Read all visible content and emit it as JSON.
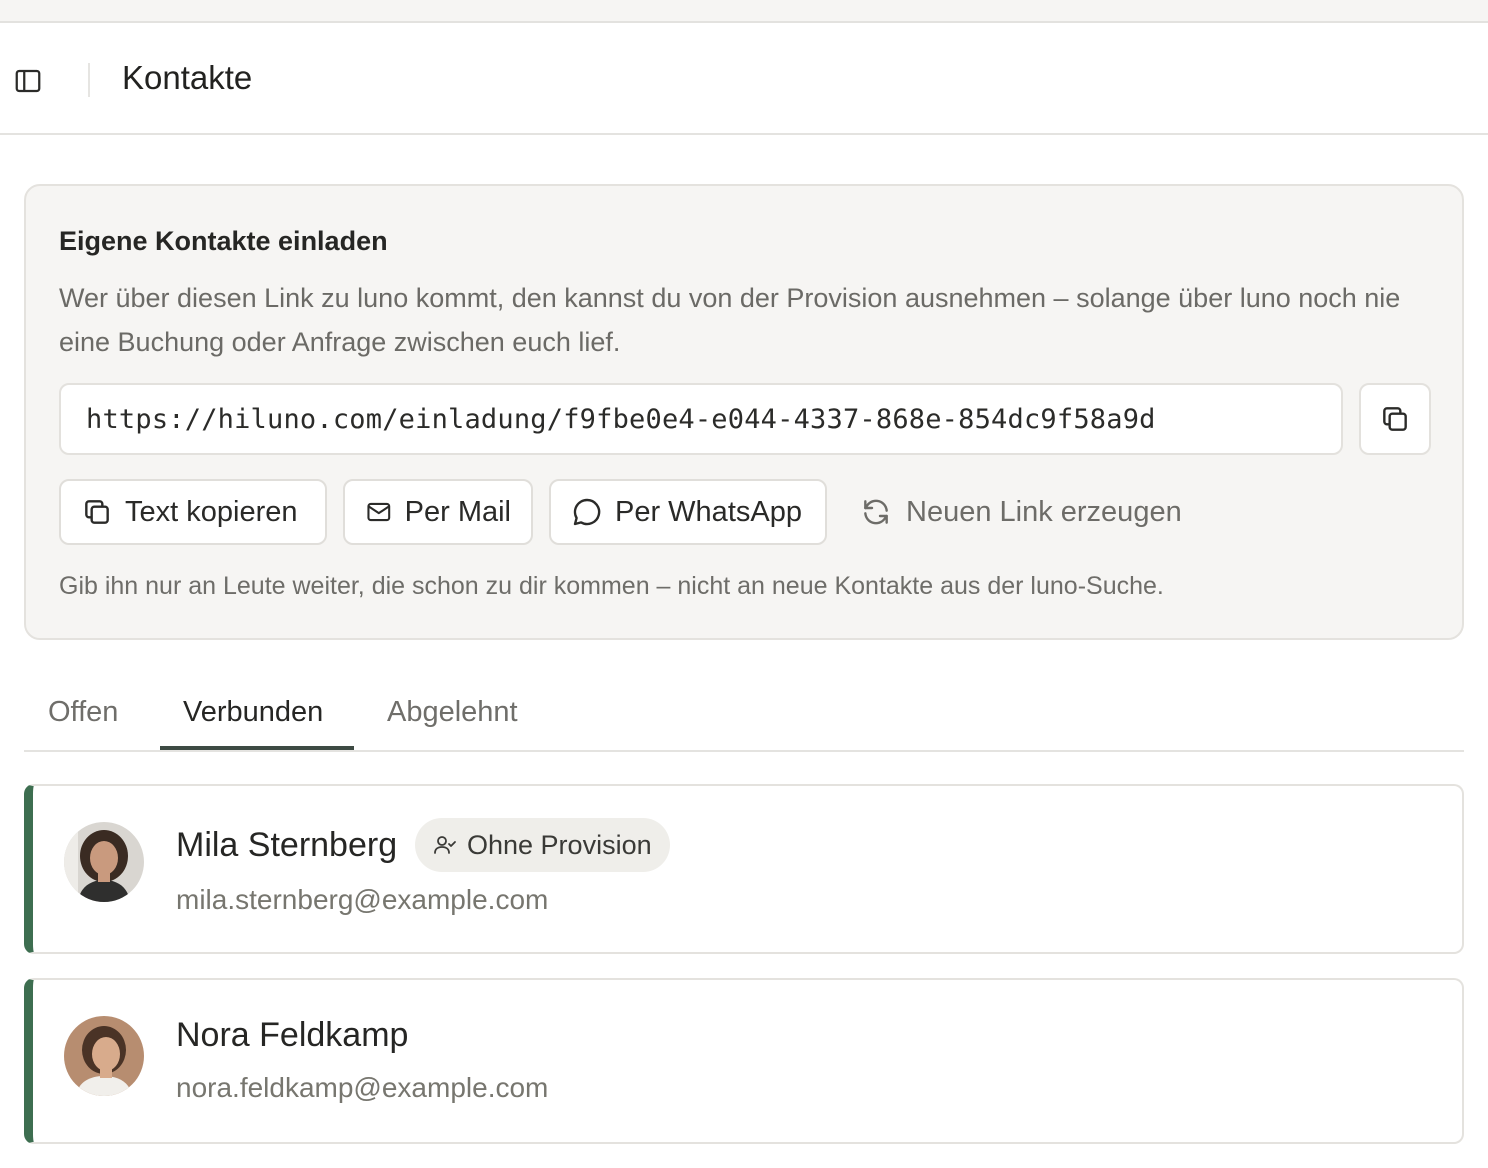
{
  "header": {
    "title": "Kontakte",
    "sidebar_toggle_icon": "sidebar-panel-icon"
  },
  "invite": {
    "title": "Eigene Kontakte einladen",
    "description": "Wer über diesen Link zu luno kommt, den kannst du von der Provision ausnehmen – solange über luno noch nie eine Buchung oder Anfrage zwischen euch lief.",
    "link": "https://hiluno.com/einladung/f9fbe0e4-e044-4337-868e-854dc9f58a9d",
    "buttons": {
      "copy_text": "Text kopieren",
      "mail": "Per Mail",
      "whatsapp": "Per WhatsApp",
      "regenerate": "Neuen Link erzeugen"
    },
    "hint": "Gib ihn nur an Leute weiter, die schon zu dir kommen – nicht an neue Kontakte aus der luno-Suche."
  },
  "tabs": [
    {
      "label": "Offen",
      "active": false
    },
    {
      "label": "Verbunden",
      "active": true
    },
    {
      "label": "Abgelehnt",
      "active": false
    }
  ],
  "contacts": [
    {
      "name": "Mila Sternberg",
      "email": "mila.sternberg@example.com",
      "badge": "Ohne Provision"
    },
    {
      "name": "Nora Feldkamp",
      "email": "nora.feldkamp@example.com"
    }
  ],
  "colors": {
    "accent_green": "#3d6e50",
    "card_bg": "#f6f5f3",
    "tab_underline": "#3d4a43"
  }
}
